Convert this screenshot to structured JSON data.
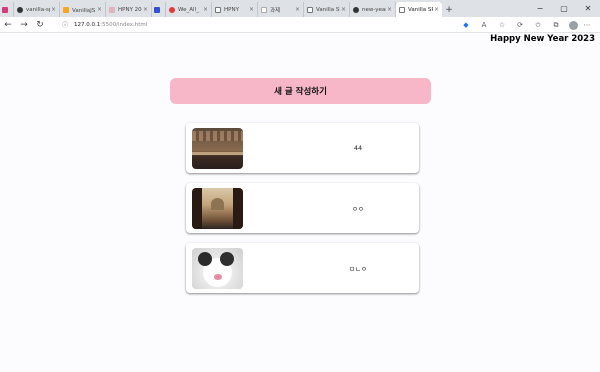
{
  "browser": {
    "tabs": [
      {
        "title": "",
        "favicon_color": "#d63a7a"
      },
      {
        "title": "vanilla-spa-b",
        "favicon_color": "#333333"
      },
      {
        "title": "VanillaJS 로",
        "favicon_color": "#f5a623"
      },
      {
        "title": "HPNY 2023",
        "favicon_color": "#e0b3c0"
      },
      {
        "title": "",
        "favicon_color": "#3050d6"
      },
      {
        "title": "We_All_",
        "favicon_color": "#e33b3b"
      },
      {
        "title": "HPNY",
        "favicon_color": "#777777"
      },
      {
        "title": "과제",
        "favicon_color": "#aaaaaa"
      },
      {
        "title": "Vanilla SPA",
        "favicon_color": "#777777"
      },
      {
        "title": "new-year-",
        "favicon_color": "#333333"
      },
      {
        "title": "Vanilla SPA",
        "favicon_color": "#777777",
        "active": true
      }
    ],
    "new_tab": "+",
    "window_controls": {
      "minimize": "−",
      "maximize": "▢",
      "close": "✕"
    },
    "address": {
      "host": "127.0.0.1",
      "path": ":5500/index.html"
    },
    "nav": {
      "back": "←",
      "forward": "→",
      "reload": "↻"
    }
  },
  "page": {
    "greeting": "Happy New Year 2023",
    "write_button": "새 글 작성하기",
    "posts": [
      {
        "text": "44",
        "thumb": "market-street-photo"
      },
      {
        "text": "ㅇㅇ",
        "thumb": "cathedral-square-photo"
      },
      {
        "text": "ㅁㄴㅇ",
        "thumb": "black-white-cat-photo"
      }
    ]
  }
}
